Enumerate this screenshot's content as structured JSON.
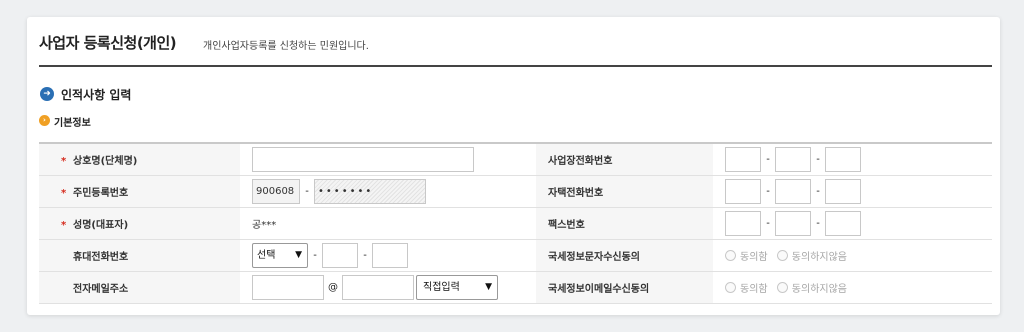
{
  "header": {
    "title": "사업자 등록신청(개인)",
    "description": "개인사업자등록를 신청하는 민원입니다."
  },
  "section_main": {
    "icon": "arrow-right-circle-icon",
    "title": "인적사항 입력"
  },
  "section_sub": {
    "icon": "arrow-right-circle-icon",
    "title": "기본정보"
  },
  "required_mark": "*",
  "dash": "-",
  "at_sign": "@",
  "fields": {
    "company_name": {
      "label": "상호명(단체명)",
      "value": ""
    },
    "resident_number": {
      "label": "주민등록번호",
      "front_value": "900608",
      "back_value": "•••••••"
    },
    "representative": {
      "label": "성명(대표자)",
      "value": "공***"
    },
    "mobile": {
      "label": "휴대전화번호",
      "select_value": "선택",
      "middle": "",
      "last": ""
    },
    "email": {
      "label": "전자메일주소",
      "id_value": "",
      "domain_value": "",
      "domain_select": "직접입력"
    },
    "business_phone": {
      "label": "사업장전화번호",
      "p1": "",
      "p2": "",
      "p3": ""
    },
    "home_phone": {
      "label": "자택전화번호",
      "p1": "",
      "p2": "",
      "p3": ""
    },
    "fax": {
      "label": "팩스번호",
      "p1": "",
      "p2": "",
      "p3": ""
    },
    "sms_consent": {
      "label": "국세정보문자수신동의",
      "agree": "동의함",
      "disagree": "동의하지않음"
    },
    "email_consent": {
      "label": "국세정보이메일수신동의",
      "agree": "동의함",
      "disagree": "동의하지않음"
    }
  },
  "colors": {
    "accent_blue": "#2a6fb4",
    "accent_orange": "#f0a024",
    "required_red": "#d52b1e"
  }
}
